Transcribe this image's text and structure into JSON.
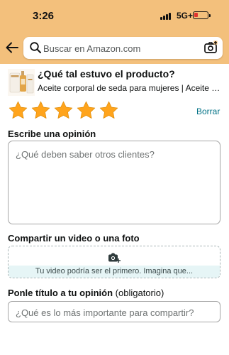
{
  "status_bar": {
    "time": "3:26",
    "network": "5G+",
    "battery_color": "#e0342f"
  },
  "header": {
    "bg_color": "#f3c07c",
    "back_icon": "back-arrow-icon",
    "search_placeholder": "Buscar en Amazon.com",
    "camera_icon": "camera-search-icon"
  },
  "product": {
    "question": "¿Qué tal estuvo el producto?",
    "name": "Aceite corporal de seda para mujeres | Aceite corporal..."
  },
  "rating": {
    "stars_selected": 5,
    "stars_total": 5,
    "star_color": "#ffa41c",
    "clear_label": "Borrar"
  },
  "review": {
    "label": "Escribe una opinión",
    "placeholder": "¿Qué deben saber otros clientes?"
  },
  "media": {
    "label": "Compartir un video o una foto",
    "hint": "Tu video podría ser el primero. Imagina que..."
  },
  "headline": {
    "label": "Ponle título a tu opinión",
    "label_note": "(obligatorio)",
    "placeholder": "¿Qué es lo más importante para compartir?"
  }
}
